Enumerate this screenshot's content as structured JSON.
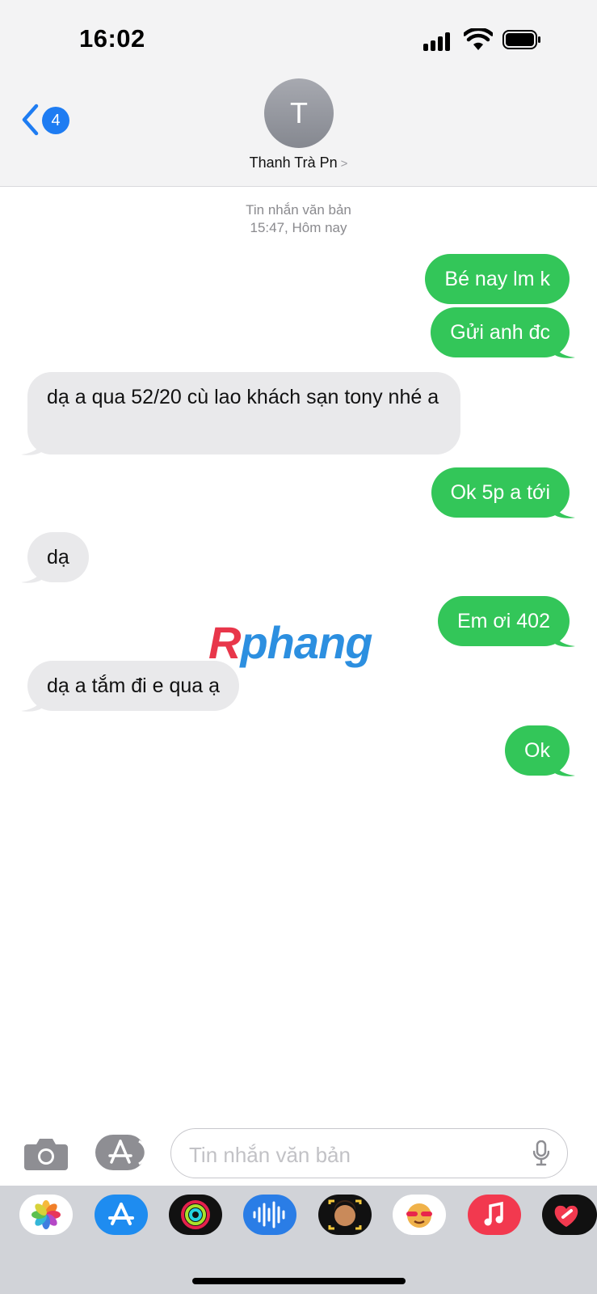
{
  "status_bar": {
    "time": "16:02"
  },
  "nav": {
    "back_badge": "4",
    "avatar_initial": "T",
    "contact_name": "Thanh Trà Pn",
    "chevron": ">"
  },
  "thread_meta": {
    "type": "Tin nhắn văn bản",
    "timestamp": "15:47, Hôm nay"
  },
  "messages": [
    {
      "direction": "out",
      "text": "Bé nay lm k"
    },
    {
      "direction": "out",
      "text": "Gửi anh đc"
    },
    {
      "direction": "in",
      "text": "dạ a qua 52/20 cù lao khách sạn tony nhé a"
    },
    {
      "direction": "out",
      "text": "Ok 5p a tới"
    },
    {
      "direction": "in",
      "text": "dạ"
    },
    {
      "direction": "out",
      "text": "Em ơi 402"
    },
    {
      "direction": "in",
      "text": "dạ a tắm đi e qua ạ"
    },
    {
      "direction": "out",
      "text": "Ok"
    }
  ],
  "watermark": {
    "r": "R",
    "rest": "phang"
  },
  "composer": {
    "placeholder": "Tin nhắn văn bản"
  },
  "app_tray": [
    "photos-icon",
    "app-store-icon",
    "fitness-icon",
    "audio-message-icon",
    "memoji-icon",
    "memoji-stickers-icon",
    "music-icon",
    "digital-touch-icon"
  ],
  "colors": {
    "outgoing": "#33c659",
    "incoming": "#e9e9eb",
    "accent": "#1e7cf2"
  }
}
